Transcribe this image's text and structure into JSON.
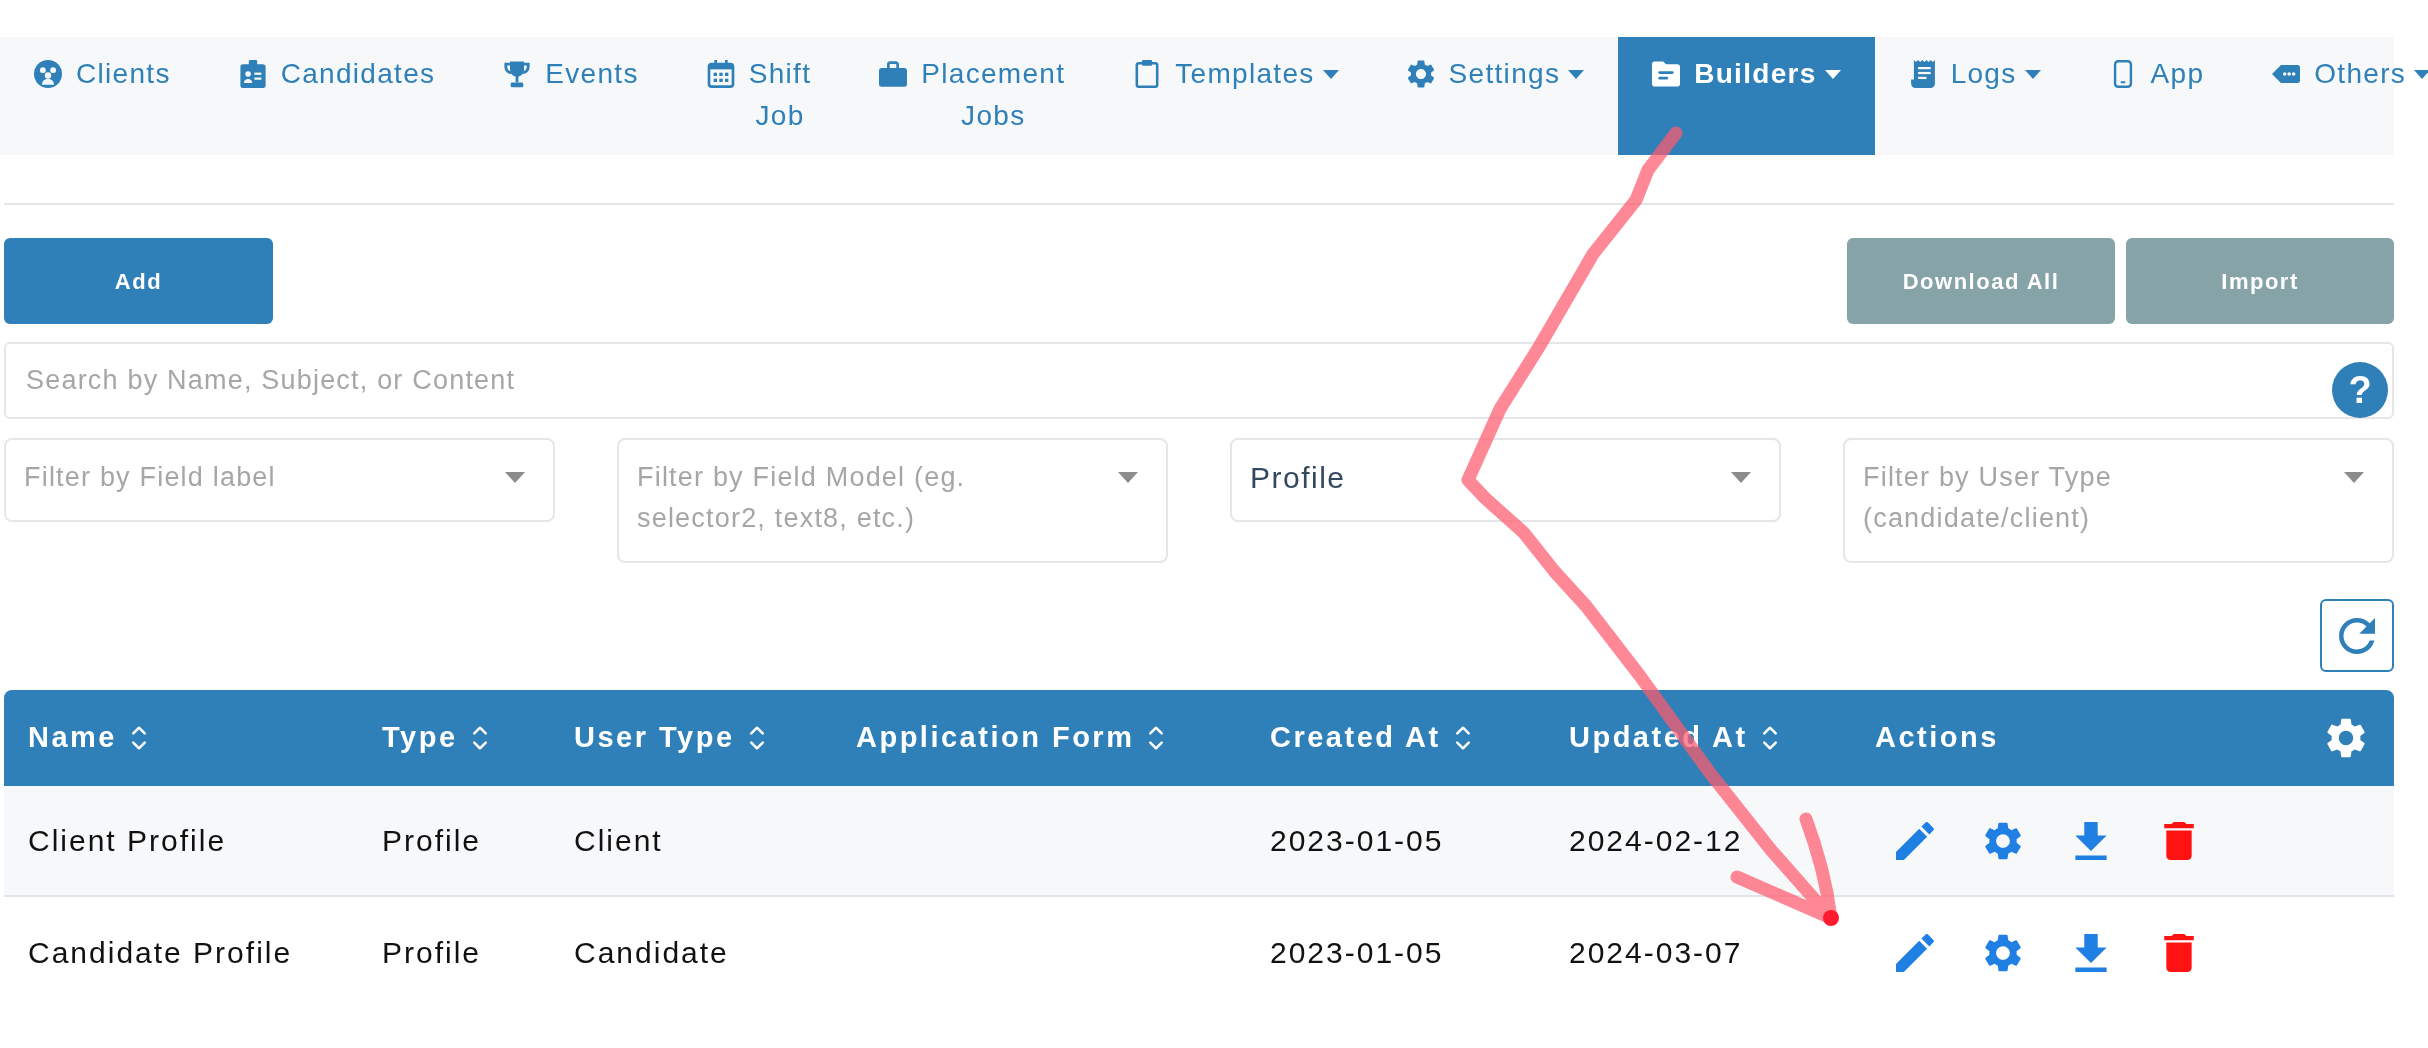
{
  "nav": [
    {
      "label": "Clients",
      "dropdown": false,
      "selected": false
    },
    {
      "label": "Candidates",
      "dropdown": false,
      "selected": false
    },
    {
      "label": "Events",
      "dropdown": false,
      "selected": false
    },
    {
      "label": "Shift Job",
      "dropdown": false,
      "selected": false
    },
    {
      "label": "Placement Jobs",
      "dropdown": false,
      "selected": false
    },
    {
      "label": "Templates",
      "dropdown": true,
      "selected": false
    },
    {
      "label": "Settings",
      "dropdown": true,
      "selected": false
    },
    {
      "label": "Builders",
      "dropdown": true,
      "selected": true
    },
    {
      "label": "Logs",
      "dropdown": true,
      "selected": false
    },
    {
      "label": "App",
      "dropdown": false,
      "selected": false
    },
    {
      "label": "Others",
      "dropdown": true,
      "selected": false
    }
  ],
  "toolbar": [
    {
      "label": "Add",
      "kind": "primary"
    },
    {
      "label": "Download All",
      "kind": "secondary"
    },
    {
      "label": "Import",
      "kind": "secondary"
    }
  ],
  "search": {
    "placeholder": "Search by Name, Subject, or Content",
    "help": "?"
  },
  "filters": [
    {
      "placeholder": "Filter by Field label"
    },
    {
      "placeholder": "Filter by Field Model (eg. selector2, text8, etc.)"
    },
    {
      "value": "Profile"
    },
    {
      "placeholder": "Filter by User Type (candidate/client)"
    }
  ],
  "table": {
    "columns": [
      {
        "label": "Name",
        "sortable": true
      },
      {
        "label": "Type",
        "sortable": true
      },
      {
        "label": "User Type",
        "sortable": true
      },
      {
        "label": "Application Form",
        "sortable": true
      },
      {
        "label": "Created At",
        "sortable": true
      },
      {
        "label": "Updated At",
        "sortable": true
      },
      {
        "label": "Actions",
        "sortable": false
      }
    ],
    "rows": [
      {
        "name": "Client Profile",
        "type": "Profile",
        "user_type": "Client",
        "created_at": "2023-01-05",
        "updated_at": "2024-02-12"
      },
      {
        "name": "Candidate Profile",
        "type": "Profile",
        "user_type": "Candidate",
        "created_at": "2023-01-05",
        "updated_at": "2024-03-07"
      }
    ]
  },
  "annotation": {
    "kind": "arrow"
  }
}
